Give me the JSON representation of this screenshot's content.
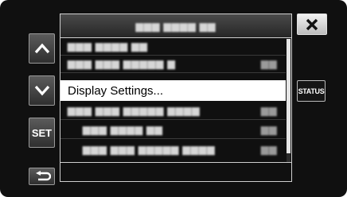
{
  "header": {
    "title": "▆▆▆ ▆▆▆▆ ▆▆"
  },
  "menu": {
    "items": [
      {
        "label": "▆▆▆ ▆▆▆▆ ▆▆",
        "value": "",
        "indent": false
      },
      {
        "label": "▆▆▆ ▆▆▆ ▆▆▆▆▆ ▆",
        "value": "▆▆",
        "indent": false
      },
      {
        "label": "Display Settings...",
        "value": "",
        "indent": false,
        "selected": true
      },
      {
        "label": "▆▆▆ ▆▆▆ ▆▆▆▆▆ ▆▆▆▆",
        "value": "▆▆",
        "indent": false
      },
      {
        "label": "▆▆▆ ▆▆▆▆ ▆▆",
        "value": "▆▆",
        "indent": true
      },
      {
        "label": "▆▆▆ ▆▆▆ ▆▆▆▆▆ ▆▆▆▆",
        "value": "▆▆",
        "indent": true
      }
    ]
  },
  "buttons": {
    "set": "SET",
    "status": "STATUS"
  },
  "icons": {
    "up": "chevron-up-icon",
    "down": "chevron-down-icon",
    "back": "return-arrow-icon",
    "close": "close-icon"
  }
}
